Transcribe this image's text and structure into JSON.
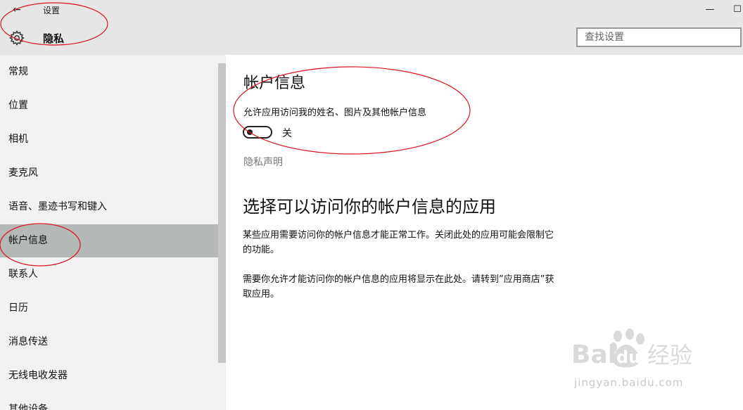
{
  "window": {
    "back_icon": "back-arrow-icon",
    "back_glyph": "←",
    "title": "设置",
    "minimize_glyph": "—",
    "maximize_glyph": "☐"
  },
  "header": {
    "icon": "gear-icon",
    "section_title": "隐私",
    "search_placeholder": "查找设置"
  },
  "sidebar": {
    "selected_index": 5,
    "items": [
      {
        "label": "常规"
      },
      {
        "label": "位置"
      },
      {
        "label": "相机"
      },
      {
        "label": "麦克风"
      },
      {
        "label": "语音、墨迹书写和键入"
      },
      {
        "label": "帐户信息"
      },
      {
        "label": "联系人"
      },
      {
        "label": "日历"
      },
      {
        "label": "消息传送"
      },
      {
        "label": "无线电收发器"
      },
      {
        "label": "其他设备"
      }
    ]
  },
  "main": {
    "heading": "帐户信息",
    "toggle_description": "允许应用访问我的姓名、图片及其他帐户信息",
    "toggle_state": "关",
    "toggle_on": false,
    "privacy_link": "隐私声明",
    "subheading": "选择可以访问你的帐户信息的应用",
    "paragraph1": "某些应用需要访问你的帐户信息才能正常工作。关闭此处的应用可能会限制它的功能。",
    "paragraph2": "需要你允许才能访问你的帐户信息的应用将显示在此处。请转到”应用商店”获取应用。"
  },
  "colors": {
    "titlebar_bg": "#e6e6e6",
    "sidebar_bg": "#f2f2f2",
    "selected_bg": "#b4b8b6",
    "annotation_red": "#d9141e",
    "watermark": "#c9c9c9"
  },
  "watermark": {
    "logo_text": "Bai du 经验",
    "url": "jingyan.baidu.com"
  }
}
